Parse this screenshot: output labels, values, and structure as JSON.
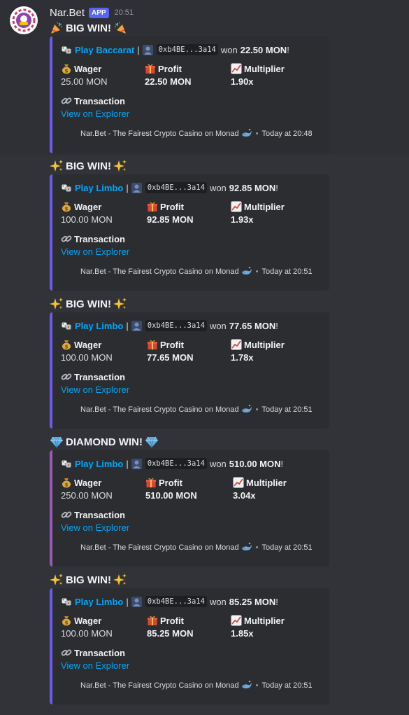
{
  "message": {
    "username": "Nar.Bet",
    "badge": "APP",
    "time": "20:51"
  },
  "embeds": [
    {
      "title": "BIG WIN!",
      "title_icon": "party-popper-icon",
      "game_link": "Play Baccarat",
      "address": "0xb4BE...3a14",
      "won_text": "won",
      "won_amount": "22.50 MON",
      "won_suffix": "!",
      "wager_label": "Wager",
      "wager_value": "25.00 MON",
      "profit_label": "Profit",
      "profit_value": "22.50 MON",
      "multiplier_label": "Multiplier",
      "multiplier_value": "1.90x",
      "transaction_label": "Transaction",
      "transaction_link": "View on Explorer",
      "footer_text": "Nar.Bet - The Fairest Crypto Casino on Monad",
      "footer_time": "Today at 20:48"
    },
    {
      "title": "BIG WIN!",
      "title_icon": "sparkles-icon",
      "game_link": "Play Limbo",
      "address": "0xb4BE...3a14",
      "won_text": "won",
      "won_amount": "92.85 MON",
      "won_suffix": "!",
      "wager_label": "Wager",
      "wager_value": "100.00 MON",
      "profit_label": "Profit",
      "profit_value": "92.85 MON",
      "multiplier_label": "Multiplier",
      "multiplier_value": "1.93x",
      "transaction_label": "Transaction",
      "transaction_link": "View on Explorer",
      "footer_text": "Nar.Bet - The Fairest Crypto Casino on Monad",
      "footer_time": "Today at 20:51"
    },
    {
      "title": "BIG WIN!",
      "title_icon": "sparkles-icon",
      "game_link": "Play Limbo",
      "address": "0xb4BE...3a14",
      "won_text": "won",
      "won_amount": "77.65 MON",
      "won_suffix": "!",
      "wager_label": "Wager",
      "wager_value": "100.00 MON",
      "profit_label": "Profit",
      "profit_value": "77.65 MON",
      "multiplier_label": "Multiplier",
      "multiplier_value": "1.78x",
      "transaction_label": "Transaction",
      "transaction_link": "View on Explorer",
      "footer_text": "Nar.Bet - The Fairest Crypto Casino on Monad",
      "footer_time": "Today at 20:51"
    },
    {
      "title": "DIAMOND WIN!",
      "title_icon": "gem-icon",
      "game_link": "Play Limbo",
      "address": "0xb4BE...3a14",
      "won_text": "won",
      "won_amount": "510.00 MON",
      "won_suffix": "!",
      "wager_label": "Wager",
      "wager_value": "250.00 MON",
      "profit_label": "Profit",
      "profit_value": "510.00 MON",
      "multiplier_label": "Multiplier",
      "multiplier_value": "3.04x",
      "transaction_label": "Transaction",
      "transaction_link": "View on Explorer",
      "footer_text": "Nar.Bet - The Fairest Crypto Casino on Monad",
      "footer_time": "Today at 20:51"
    },
    {
      "title": "BIG WIN!",
      "title_icon": "sparkles-icon",
      "game_link": "Play Limbo",
      "address": "0xb4BE...3a14",
      "won_text": "won",
      "won_amount": "85.25 MON",
      "won_suffix": "!",
      "wager_label": "Wager",
      "wager_value": "100.00 MON",
      "profit_label": "Profit",
      "profit_value": "85.25 MON",
      "multiplier_label": "Multiplier",
      "multiplier_value": "1.85x",
      "transaction_label": "Transaction",
      "transaction_link": "View on Explorer",
      "footer_text": "Nar.Bet - The Fairest Crypto Casino on Monad",
      "footer_time": "Today at 20:51"
    }
  ],
  "colors": {
    "background": "#313338",
    "embed_bg": "#2b2d31",
    "embed_border": "#6c5ce7",
    "embed_border_diamond": "#9b59b6",
    "link": "#00a8fc",
    "badge": "#5865f2"
  }
}
